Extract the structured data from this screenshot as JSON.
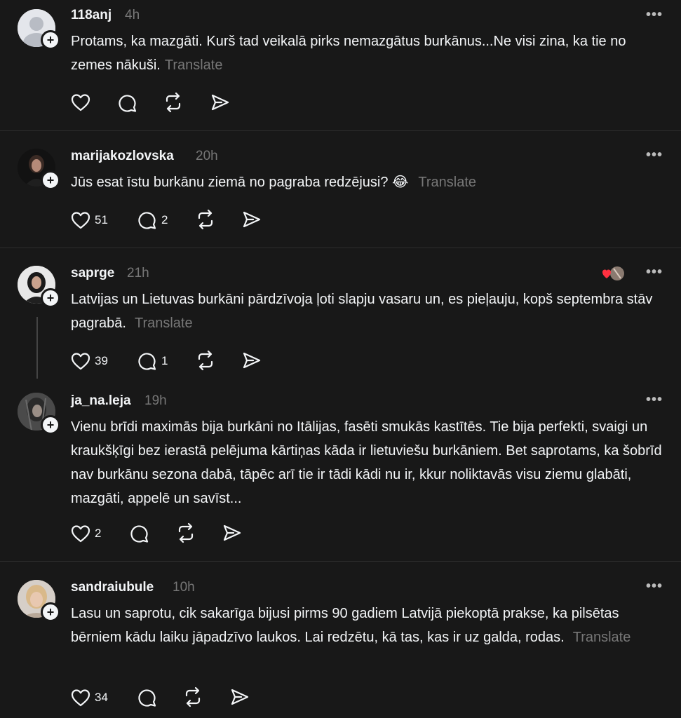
{
  "posts": [
    {
      "username": "118anj",
      "time": "4h",
      "text": "Protams, ka mazgāti. Kurš tad veikalā pirks nemazgātus burkānus...Ne visi zina, ka tie no zemes nākuši.",
      "translate": "Translate",
      "likes": "",
      "replies": ""
    },
    {
      "username": "marijakozlovska",
      "time": "20h",
      "text": "Jūs esat īstu burkānu ziemā no pagraba redzējusi? 😂",
      "translate": "Translate",
      "likes": "51",
      "replies": "2"
    },
    {
      "username": "saprge",
      "time": "21h",
      "text": "Latvijas un Lietuvas burkāni pārdzīvoja ļoti slapju vasaru un, es pieļauju, kopš septembra stāv pagrabā.",
      "translate": "Translate",
      "likes": "39",
      "replies": "1"
    },
    {
      "username": "ja_na.leja",
      "time": "19h",
      "text": "Vienu brīdi maximās bija burkāni no Itālijas, fasēti smukās kastītēs. Tie bija perfekti, svaigi un kraukšķīgi bez ierastā pelējuma kārtiņas kāda ir lietuviešu burkāniem. Bet saprotams, ka šobrīd nav burkānu sezona dabā, tāpēc arī tie ir tādi kādi nu ir, kkur noliktavās visu ziemu glabāti, mazgāti, appelē un savīst...",
      "translate": "",
      "likes": "2",
      "replies": ""
    },
    {
      "username": "sandraiubule",
      "time": "10h",
      "text": "Lasu un saprotu, cik sakarīga bijusi pirms 90 gadiem Latvijā piekoptā prakse, ka pilsētas bērniem kādu laiku jāpadzīvo laukos. Lai redzētu, kā tas, kas ir uz galda, rodas.",
      "translate": "Translate",
      "likes": "34",
      "replies": ""
    }
  ],
  "ui": {
    "more_label": "•••",
    "plus_label": "+",
    "icons": [
      "heart-icon",
      "comment-icon",
      "repost-icon",
      "share-icon"
    ],
    "colors": {
      "background": "#181818",
      "text": "#f3f5f7",
      "muted": "#777777",
      "like_red": "#ff3040"
    }
  }
}
